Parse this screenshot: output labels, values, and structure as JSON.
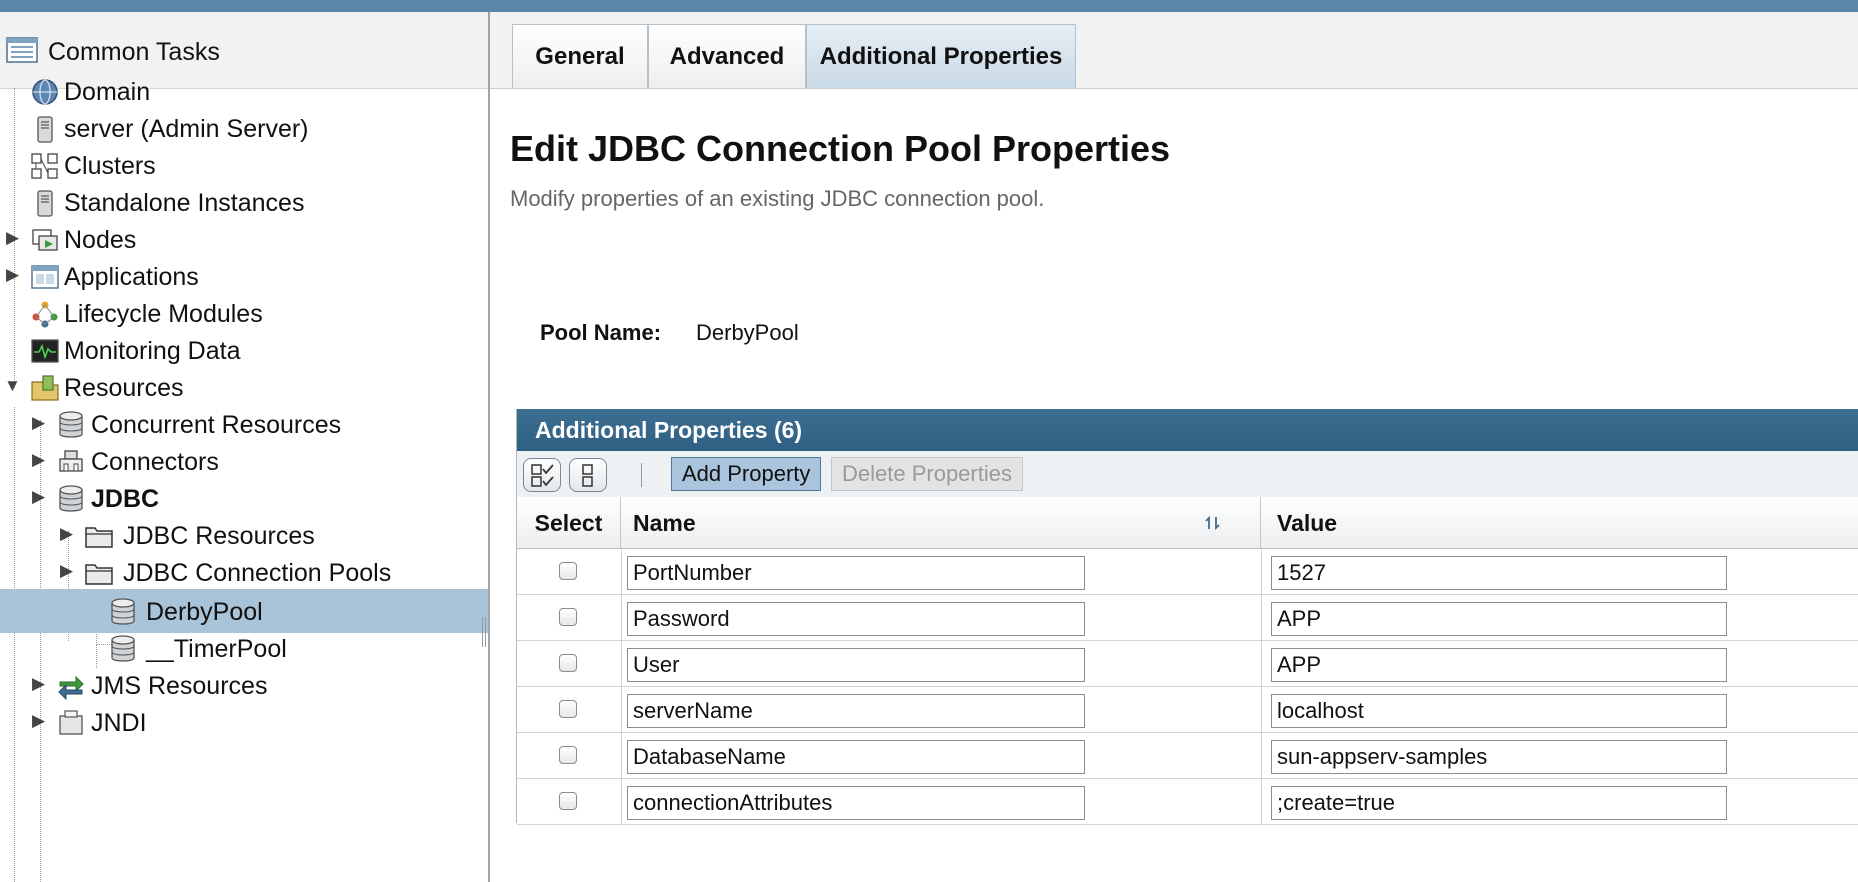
{
  "sidebar": {
    "header": "Common Tasks",
    "items": [
      {
        "label": "Domain",
        "icon": "globe-icon"
      },
      {
        "label": "server (Admin Server)",
        "icon": "server-icon"
      },
      {
        "label": "Clusters",
        "icon": "cluster-icon"
      },
      {
        "label": "Standalone Instances",
        "icon": "server-icon"
      },
      {
        "label": "Nodes",
        "icon": "nodes-icon"
      },
      {
        "label": "Applications",
        "icon": "applications-icon"
      },
      {
        "label": "Lifecycle Modules",
        "icon": "lifecycle-icon"
      },
      {
        "label": "Monitoring Data",
        "icon": "monitor-icon"
      },
      {
        "label": "Resources",
        "icon": "resources-icon"
      },
      {
        "label": "Concurrent Resources",
        "icon": "database-icon"
      },
      {
        "label": "Connectors",
        "icon": "connector-icon"
      },
      {
        "label": "JDBC",
        "icon": "database-icon"
      },
      {
        "label": "JDBC Resources",
        "icon": "folder-icon"
      },
      {
        "label": "JDBC Connection Pools",
        "icon": "folder-icon"
      },
      {
        "label": "DerbyPool",
        "icon": "database-icon"
      },
      {
        "label": "__TimerPool",
        "icon": "database-icon"
      },
      {
        "label": "JMS Resources",
        "icon": "jms-icon"
      },
      {
        "label": "JNDI",
        "icon": "jndi-icon"
      }
    ]
  },
  "tabs": [
    {
      "label": "General"
    },
    {
      "label": "Advanced"
    },
    {
      "label": "Additional Properties",
      "active": true
    }
  ],
  "page": {
    "title": "Edit JDBC Connection Pool Properties",
    "subtitle": "Modify properties of an existing JDBC connection pool.",
    "pool_name_label": "Pool Name:",
    "pool_name": "DerbyPool"
  },
  "properties_table": {
    "title": "Additional Properties (6)",
    "add_button": "Add Property",
    "delete_button": "Delete Properties",
    "columns": {
      "select": "Select",
      "name": "Name",
      "value": "Value"
    },
    "rows": [
      {
        "name": "PortNumber",
        "value": "1527"
      },
      {
        "name": "Password",
        "value": "APP"
      },
      {
        "name": "User",
        "value": "APP"
      },
      {
        "name": "serverName",
        "value": "localhost"
      },
      {
        "name": "DatabaseName",
        "value": "sun-appserv-samples"
      },
      {
        "name": "connectionAttributes",
        "value": ";create=true"
      }
    ]
  },
  "colors": {
    "accent": "#2f5f83",
    "selection": "#a9c4d8",
    "topbar": "#5a87a8"
  }
}
